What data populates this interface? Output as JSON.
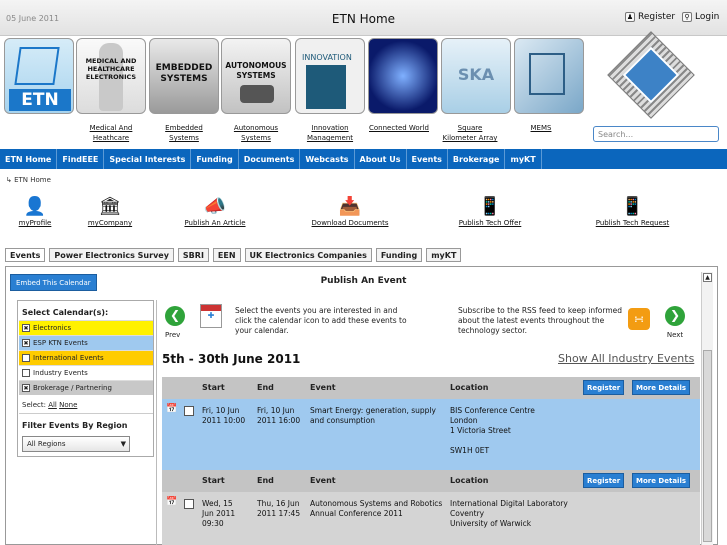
{
  "header": {
    "date": "05 June 2011",
    "title": "ETN Home",
    "register": "Register",
    "login": "Login"
  },
  "banner": {
    "etn": "ETN",
    "medical": "MEDICAL AND HEALTHCARE ELECTRONICS",
    "embedded": "EMBEDDED SYSTEMS",
    "autonomous": "AUTONOMOUS SYSTEMS",
    "innovation": "INNOVATION",
    "ska": "SKA"
  },
  "categories": [
    {
      "label": "Medical And Heathcare"
    },
    {
      "label": "Embedded Systems"
    },
    {
      "label": "Autonomous Systems"
    },
    {
      "label": "Innovation Management"
    },
    {
      "label": "Connected World"
    },
    {
      "label": "Square Kilometer Array"
    },
    {
      "label": "MEMS"
    }
  ],
  "search": {
    "placeholder": "Search..."
  },
  "nav": [
    "ETN Home",
    "FindEEE",
    "Special Interests",
    "Funding",
    "Documents",
    "Webcasts",
    "About Us",
    "Events",
    "Brokerage",
    "myKT"
  ],
  "breadcrumb": "ETN Home",
  "quick_actions": [
    "myProfile",
    "myCompany",
    "Publish An Article",
    "Download Documents",
    "Publish Tech Offer",
    "Publish Tech Request"
  ],
  "tabs": [
    "Events",
    "Power Electronics Survey",
    "SBRI",
    "EEN",
    "UK Electronics Companies",
    "Funding",
    "myKT"
  ],
  "embed_label": "Embed This Calendar",
  "publish_label": "Publish An Event",
  "calendars": {
    "title": "Select Calendar(s):",
    "items": [
      {
        "label": "Electronics",
        "checked": true,
        "color": "#fff100"
      },
      {
        "label": "ESP KTN Events",
        "checked": true,
        "color": "#9fc9ef"
      },
      {
        "label": "International Events",
        "checked": false,
        "color": "#ffcc00"
      },
      {
        "label": "Industry Events",
        "checked": false,
        "color": "#ffffff"
      },
      {
        "label": "Brokerage / Partnering",
        "checked": true,
        "color": "#c8c8c8"
      }
    ],
    "select_label": "Select:",
    "select_all": "All",
    "select_none": "None",
    "filter_title": "Filter Events By Region",
    "region": "All Regions"
  },
  "instructions": {
    "left": "Select the events you are interested in and click the calendar icon to add these events to your calendar.",
    "right": "Subscribe to the RSS feed to keep informed about the latest events throughout the technology sector.",
    "prev": "Prev",
    "next": "Next"
  },
  "range": "5th - 30th June 2011",
  "show_all": "Show All Industry Events",
  "columns": {
    "start": "Start",
    "end": "End",
    "event": "Event",
    "location": "Location"
  },
  "buttons": {
    "register": "Register",
    "details": "More Details"
  },
  "events": [
    {
      "start": [
        "Fri, 10 Jun",
        "2011 10:00"
      ],
      "end": [
        "Fri, 10 Jun",
        "2011 16:00"
      ],
      "event": [
        "Smart Energy: generation, supply",
        "and consumption"
      ],
      "location": [
        "BIS Conference Centre",
        "London",
        "1 Victoria Street",
        "",
        "SW1H 0ET"
      ]
    },
    {
      "start": [
        "Wed, 15",
        "Jun 2011",
        "09:30"
      ],
      "end": [
        "Thu, 16 Jun",
        "2011 17:45"
      ],
      "event": [
        "Autonomous Systems and Robotics",
        "Annual Conference 2011"
      ],
      "location": [
        "International Digital Laboratory",
        "Coventry",
        "University of Warwick"
      ]
    }
  ]
}
